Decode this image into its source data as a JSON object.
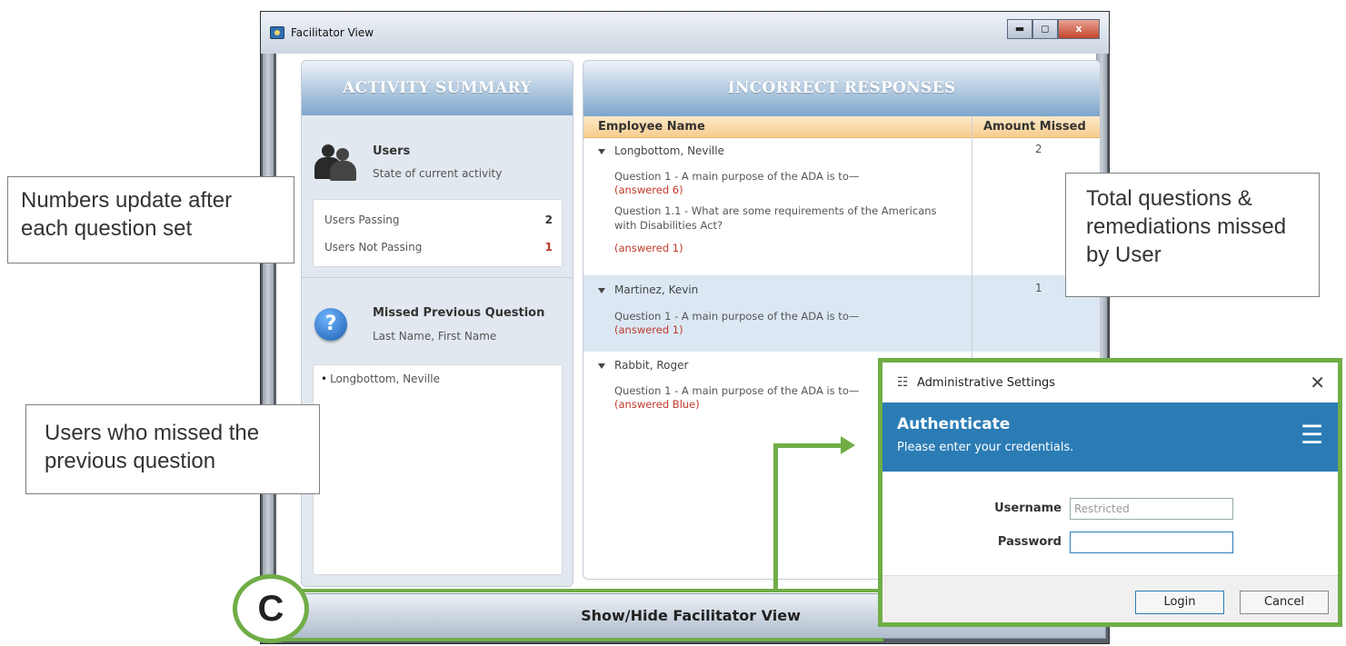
{
  "window": {
    "title": "Facilitator View",
    "controls": {
      "minimize": "▬",
      "maximize": "◻",
      "close": "x"
    }
  },
  "activity_summary": {
    "header": "ACTIVITY SUMMARY",
    "users_title": "Users",
    "users_subtitle": "State of current activity",
    "stats": [
      {
        "label": "Users Passing",
        "value": "2"
      },
      {
        "label": "Users Not Passing",
        "value": "1"
      }
    ],
    "missed_title": "Missed Previous Question",
    "missed_subtitle": "Last Name, First Name",
    "missed_users": [
      "Longbottom, Neville"
    ]
  },
  "incorrect_responses": {
    "header": "INCORRECT RESPONSES",
    "col_name": "Employee Name",
    "col_amount": "Amount Missed",
    "groups": [
      {
        "name": "Longbottom, Neville",
        "amount": "2",
        "items": [
          {
            "question": "Question 1 - A main purpose of the ADA is to—",
            "answer": "(answered 6)"
          },
          {
            "question": "Question 1.1 - What are some requirements of the Americans with Disabilities Act?",
            "answer": "(answered 1)"
          }
        ]
      },
      {
        "name": "Martinez, Kevin",
        "amount": "1",
        "items": [
          {
            "question": "Question 1 - A main purpose of the ADA is to—",
            "answer": "(answered 1)"
          }
        ]
      },
      {
        "name": "Rabbit, Roger",
        "amount": "",
        "items": [
          {
            "question": "Question 1 - A main purpose of the ADA is to—",
            "answer": "(answered Blue)"
          }
        ]
      }
    ]
  },
  "bottom_bar": {
    "label": "Show/Hide Facilitator View"
  },
  "callouts": {
    "numbers_update": "Numbers update after each question set",
    "total_questions": "Total questions & remediations missed by User",
    "users_missed": "Users who missed the previous question"
  },
  "badge": {
    "label": "C"
  },
  "admin_dialog": {
    "title": "Administrative Settings",
    "close": "✕",
    "heading": "Authenticate",
    "subheading": "Please enter your credentials.",
    "username_label": "Username",
    "username_value": "Restricted",
    "password_label": "Password",
    "password_value": "",
    "login_label": "Login",
    "cancel_label": "Cancel"
  },
  "colors": {
    "accent_green": "#70ad47",
    "dialog_blue": "#2b7cb5",
    "error_red": "#c0392b"
  }
}
